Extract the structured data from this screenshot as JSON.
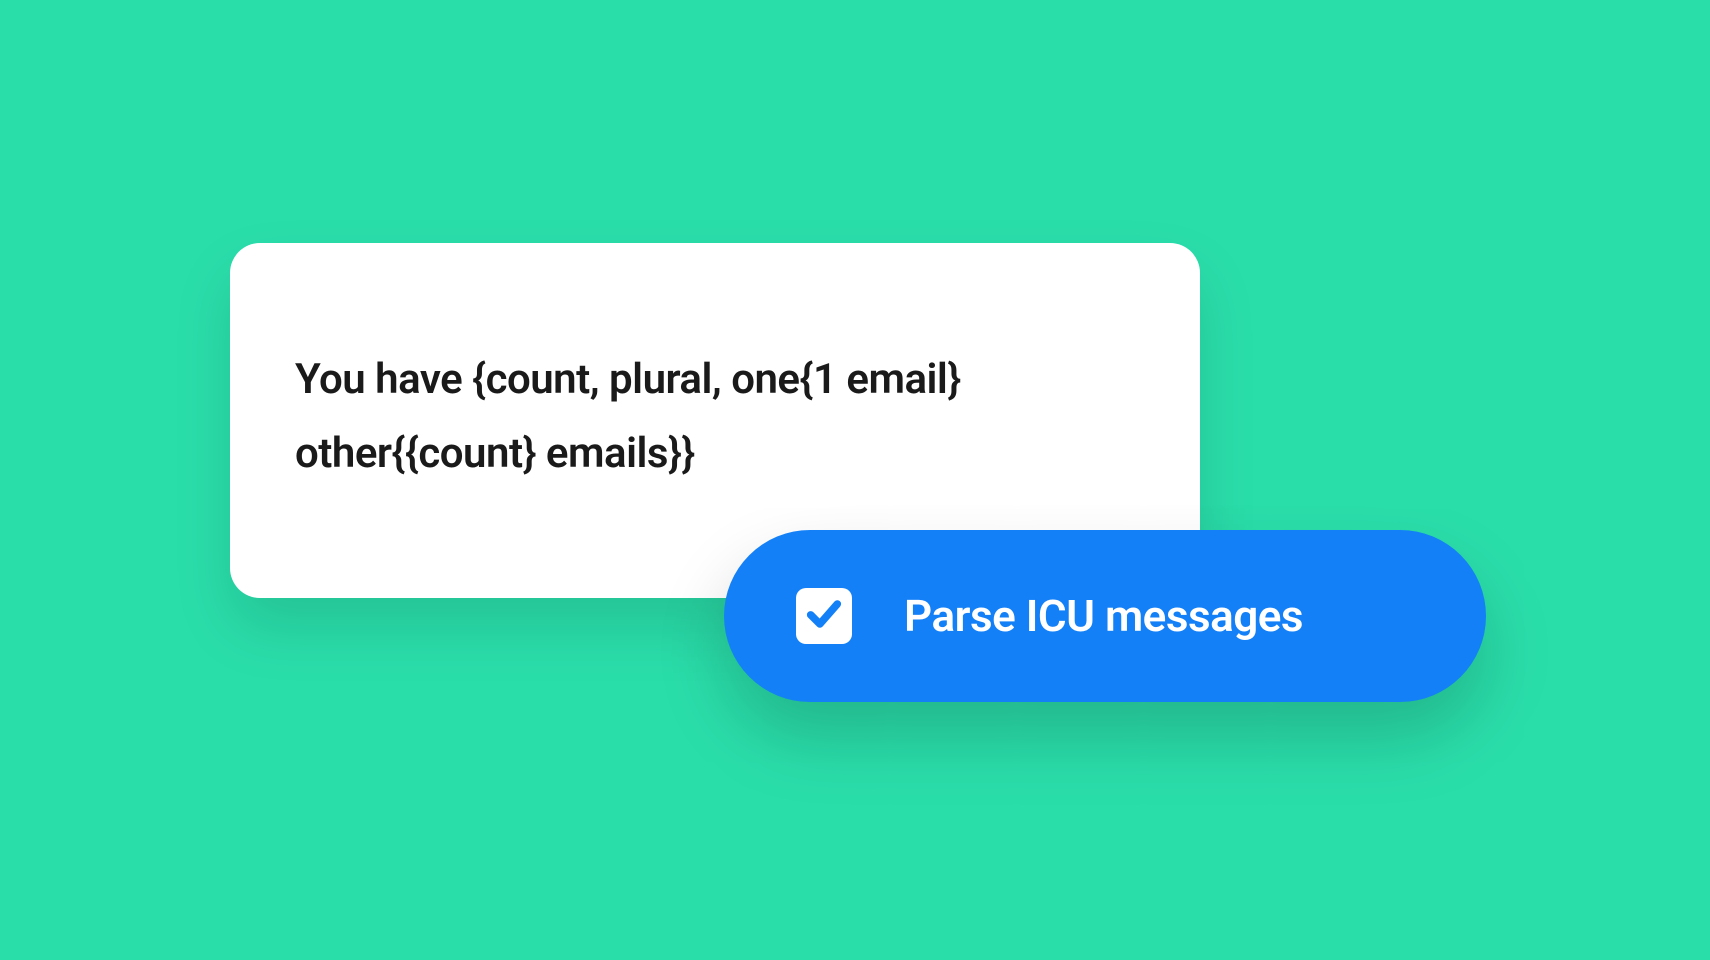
{
  "colors": {
    "background": "#2adeaa",
    "card_bg": "#ffffff",
    "text_dark": "#1a1a1a",
    "pill_bg": "#1380f7",
    "pill_text": "#ffffff"
  },
  "message_card": {
    "text": "You have {count, plural, one{1 email} other{{count} emails}}"
  },
  "option_pill": {
    "label": "Parse ICU messages",
    "checked": true
  }
}
